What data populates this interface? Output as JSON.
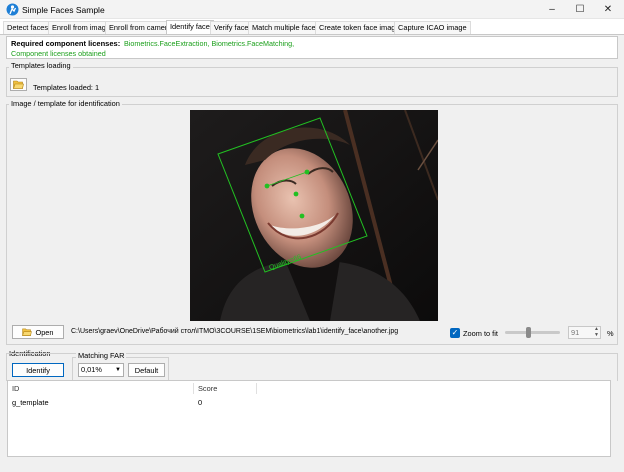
{
  "window": {
    "title": "Simple Faces Sample"
  },
  "tabs": [
    "Detect faces",
    "Enroll from image",
    "Enroll from camera",
    "Identify face",
    "Verify face",
    "Match multiple faces",
    "Create token face image",
    "Capture ICAO image"
  ],
  "licenses": {
    "label": "Required component licenses:",
    "list": "Biometrics.FaceExtraction, Biometrics.FaceMatching,",
    "status": "Component licenses obtained"
  },
  "templates": {
    "group_label": "Templates loading",
    "loaded_label": "Templates loaded:",
    "loaded_count": "1"
  },
  "image_panel": {
    "group_label": "Image / template for identification",
    "face_label": "Quality=66",
    "open_label": "Open",
    "file_path": "C:\\Users\\graev\\OneDrive\\Рабочий стол\\ITMO\\3COURSE\\1SEM\\biometrics\\lab1\\identify_face\\another.jpg",
    "zoom_label": "Zoom to fit",
    "zoom_value": "91",
    "zoom_unit": "%"
  },
  "identification": {
    "group_label": "Identification",
    "identify_label": "Identify",
    "far_label": "Matching FAR",
    "far_value": "0,01%",
    "default_label": "Default"
  },
  "results": {
    "columns": [
      "ID",
      "Score"
    ],
    "rows": [
      {
        "id": "g_template",
        "score": "0"
      }
    ]
  },
  "colors": {
    "accent": "#0067c0",
    "license_green": "#1a9f1a",
    "face_box": "#22c022"
  }
}
